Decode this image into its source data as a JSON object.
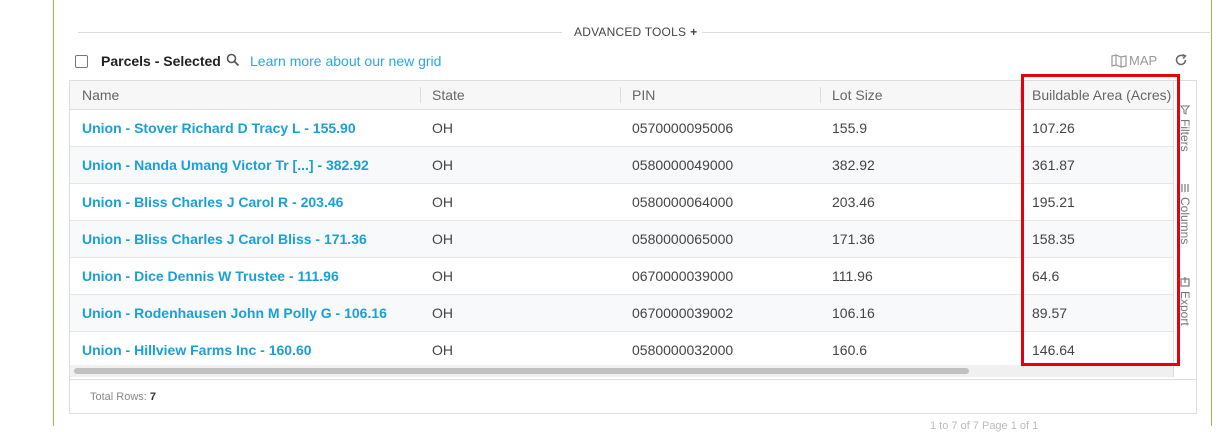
{
  "advanced_tools": {
    "label": "ADVANCED TOOLS",
    "icon": "plus-icon"
  },
  "toolbar": {
    "title": "Parcels - Selected",
    "learn_link": "Learn more about our new grid",
    "map_label": "MAP"
  },
  "columns": [
    {
      "label": "Name"
    },
    {
      "label": "State"
    },
    {
      "label": "PIN"
    },
    {
      "label": "Lot Size"
    },
    {
      "label": "Buildable Area (Acres)"
    }
  ],
  "rows": [
    {
      "name": "Union - Stover Richard D Tracy L - 155.90",
      "state": "OH",
      "pin": "0570000095006",
      "lot_size": "155.9",
      "buildable": "107.26"
    },
    {
      "name": "Union - Nanda Umang Victor Tr [...] - 382.92",
      "state": "OH",
      "pin": "0580000049000",
      "lot_size": "382.92",
      "buildable": "361.87"
    },
    {
      "name": "Union - Bliss Charles J Carol R - 203.46",
      "state": "OH",
      "pin": "0580000064000",
      "lot_size": "203.46",
      "buildable": "195.21"
    },
    {
      "name": "Union - Bliss Charles J Carol Bliss - 171.36",
      "state": "OH",
      "pin": "0580000065000",
      "lot_size": "171.36",
      "buildable": "158.35"
    },
    {
      "name": "Union - Dice Dennis W Trustee - 111.96",
      "state": "OH",
      "pin": "0670000039000",
      "lot_size": "111.96",
      "buildable": "64.6"
    },
    {
      "name": "Union - Rodenhausen John M Polly G - 106.16",
      "state": "OH",
      "pin": "0670000039002",
      "lot_size": "106.16",
      "buildable": "89.57"
    },
    {
      "name": "Union - Hillview Farms Inc - 160.60",
      "state": "OH",
      "pin": "0580000032000",
      "lot_size": "160.6",
      "buildable": "146.64"
    }
  ],
  "side_tabs": {
    "filters": "Filters",
    "columns": "Columns",
    "export": "Export"
  },
  "footer": {
    "total_label": "Total Rows:",
    "total_value": "7"
  },
  "pager_text": "1 to 7 of 7    Page 1 of 1",
  "colors": {
    "accent": "#1aa0d8",
    "highlight": "#e5000a",
    "frame": "#8cc63f"
  }
}
